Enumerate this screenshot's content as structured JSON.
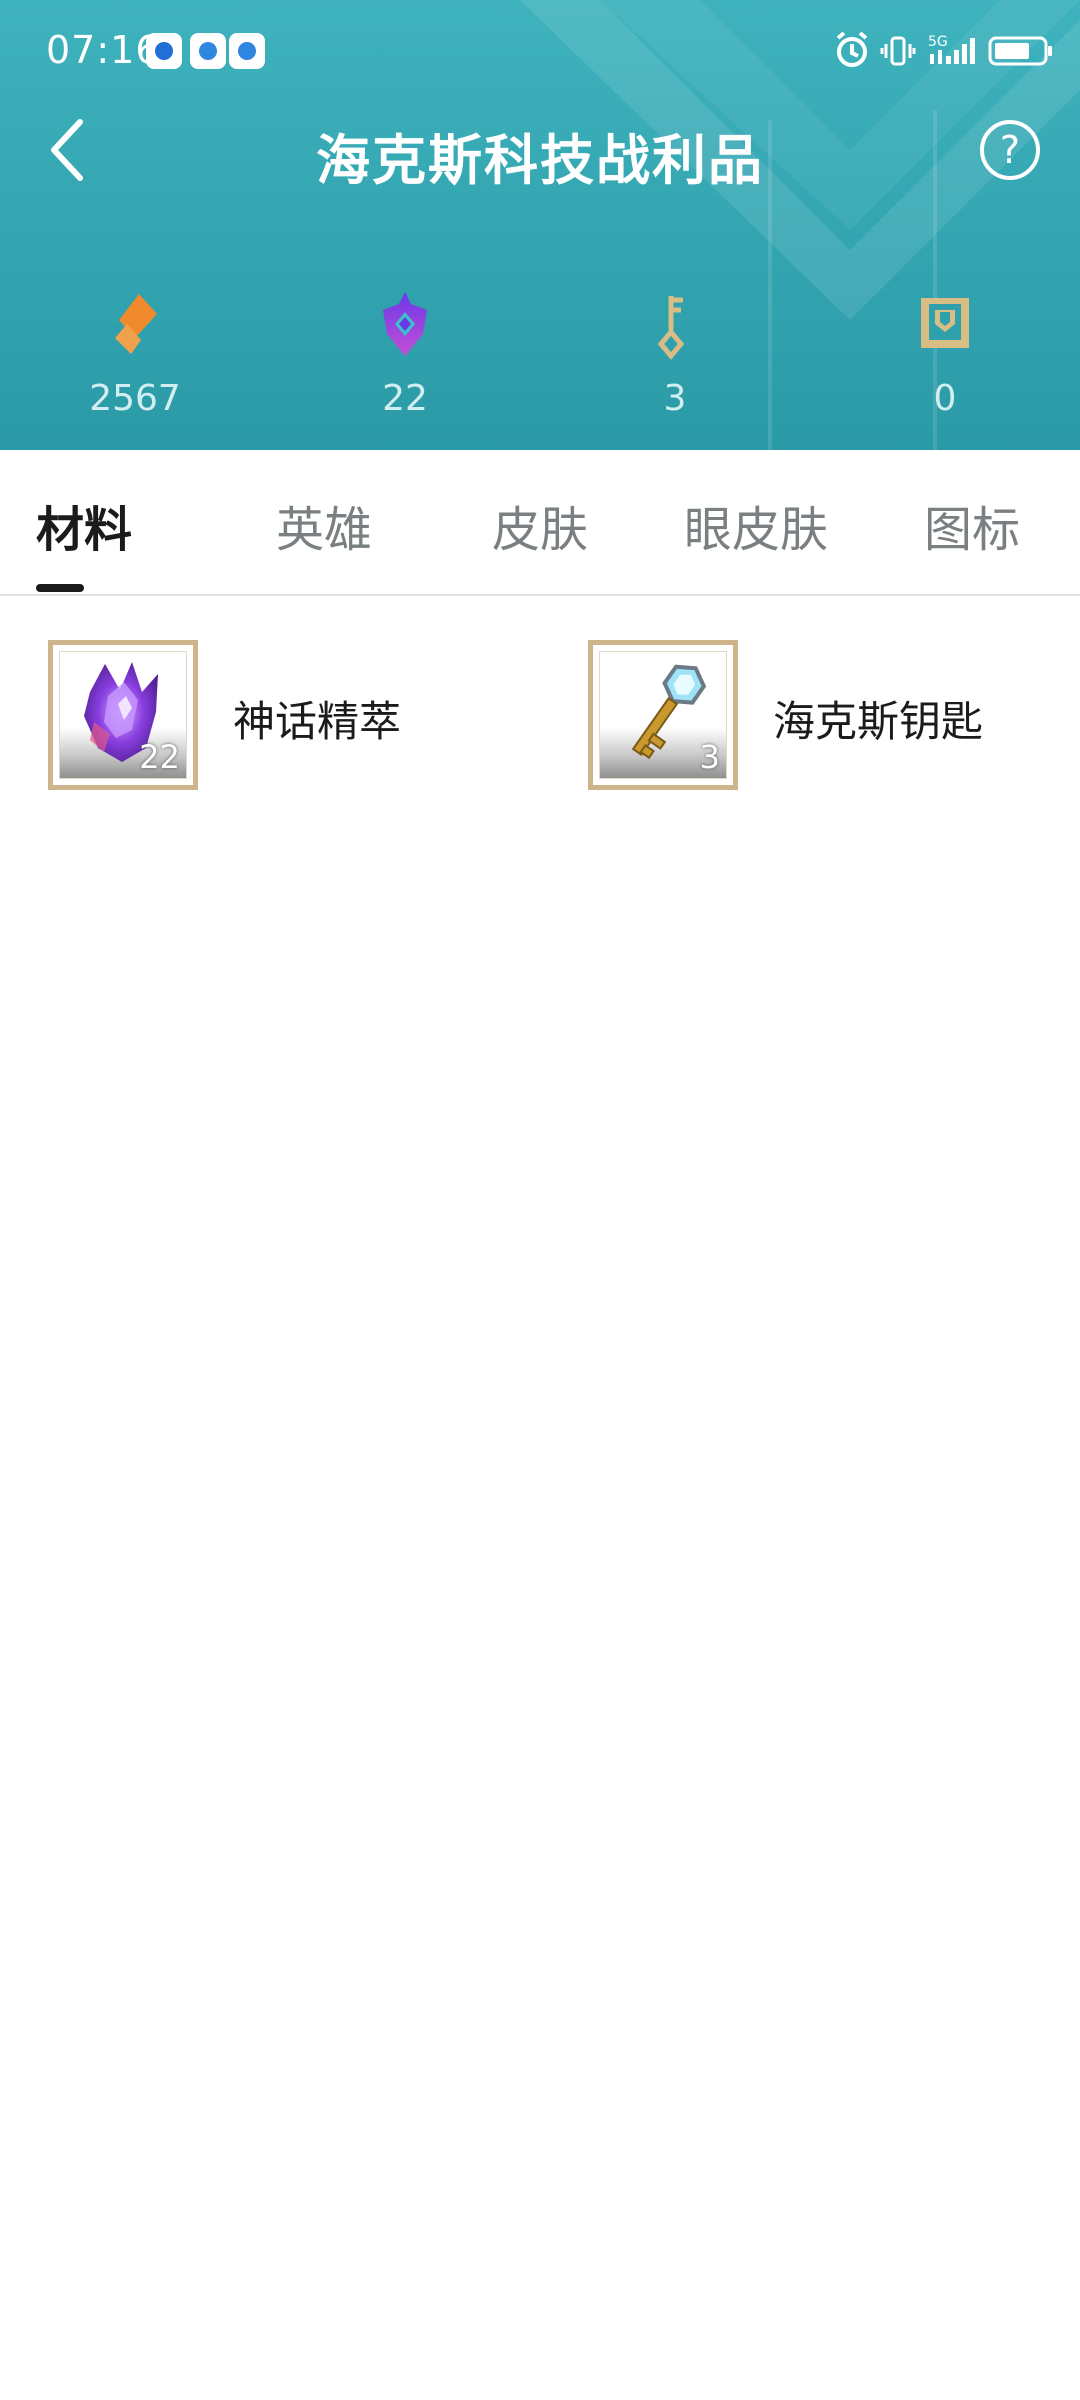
{
  "status_bar": {
    "time": "07:16",
    "icons": [
      "app-icon",
      "app-icon",
      "app-icon",
      "alarm-icon",
      "vibrate-icon",
      "signal-5g-icon",
      "battery-icon"
    ],
    "network_label": "5G"
  },
  "header": {
    "title": "海克斯科技战利品",
    "back_icon": "chevron-left-icon",
    "help_icon": "question-circle-icon",
    "background_color": "#34a7b3"
  },
  "currencies": [
    {
      "icon": "orange-essence-icon",
      "value": "2567",
      "color": "#f08a2c"
    },
    {
      "icon": "mythic-essence-icon",
      "value": "22",
      "color": "#8a3fe0"
    },
    {
      "icon": "key-fragment-icon",
      "value": "3",
      "color": "#d8bd85"
    },
    {
      "icon": "chest-icon",
      "value": "0",
      "color": "#d8bd85"
    }
  ],
  "tabs": [
    {
      "label": "材料",
      "active": true
    },
    {
      "label": "英雄",
      "active": false
    },
    {
      "label": "皮肤",
      "active": false
    },
    {
      "label": "眼皮肤",
      "active": false
    },
    {
      "label": "图标",
      "active": false
    }
  ],
  "items": [
    {
      "name": "神话精萃",
      "count": "22",
      "icon": "mythic-essence-crystal-icon"
    },
    {
      "name": "海克斯钥匙",
      "count": "3",
      "icon": "hextech-key-icon"
    }
  ]
}
